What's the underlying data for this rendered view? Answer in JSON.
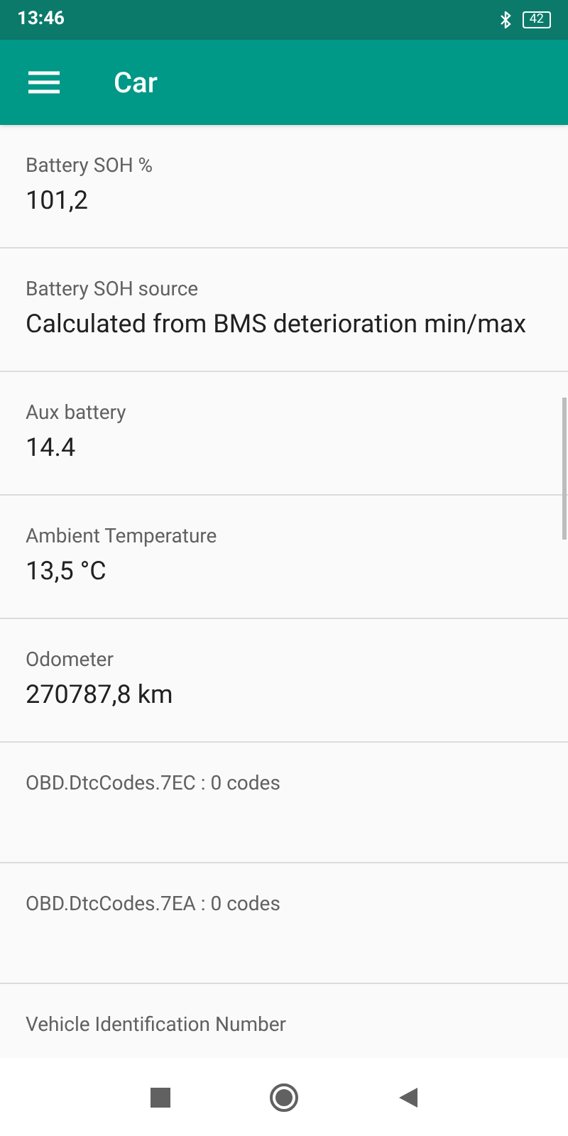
{
  "status_bar": {
    "time": "13:46",
    "battery": "42"
  },
  "app_bar": {
    "title": "Car"
  },
  "items": [
    {
      "label": "Battery SOH %",
      "value": "101,2"
    },
    {
      "label": "Battery SOH source",
      "value": "Calculated from BMS deterioration min/max"
    },
    {
      "label": "Aux battery",
      "value": "14.4"
    },
    {
      "label": "Ambient Temperature",
      "value": "13,5 °C"
    },
    {
      "label": "Odometer",
      "value": "270787,8 km"
    },
    {
      "label": "OBD.DtcCodes.7EC : 0 codes"
    },
    {
      "label": "OBD.DtcCodes.7EA : 0 codes"
    },
    {
      "label": "Vehicle Identification Number"
    }
  ]
}
